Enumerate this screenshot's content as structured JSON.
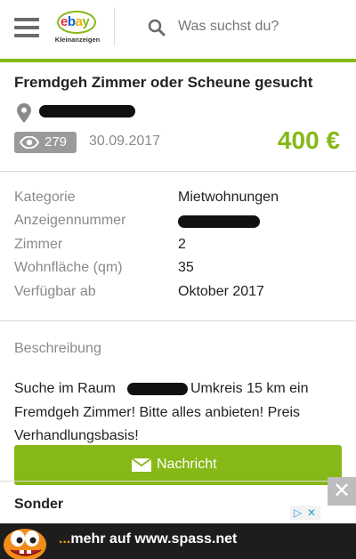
{
  "header": {
    "logo_brand": "ebay",
    "logo_sub": "Kleinanzeigen",
    "search_placeholder": "Was suchst du?"
  },
  "listing": {
    "title": "Fremdgeh Zimmer oder Scheune gesucht",
    "views": "279",
    "date": "30.09.2017",
    "price": "400 €"
  },
  "details": [
    {
      "key": "Kategorie",
      "value": "Mietwohnungen"
    },
    {
      "key": "Anzeigennummer",
      "value": ""
    },
    {
      "key": "Zimmer",
      "value": "2"
    },
    {
      "key": "Wohnfläche (qm)",
      "value": "35"
    },
    {
      "key": "Verfügbar ab",
      "value": "Oktober 2017"
    }
  ],
  "description": {
    "heading": "Beschreibung",
    "line1_a": "Suche im Raum",
    "line1_b": "Umkreis 15 km ein",
    "line2": "Fremdgeh Zimmer! Bitte alles anbieten! Preis",
    "line3": "Verhandlungsbasis!"
  },
  "contact_button": {
    "label": "Nachricht"
  },
  "cut_off_heading": "Sonder",
  "close_ad": "✕",
  "footer": {
    "dots": "...",
    "text": "mehr auf www.spass.net"
  },
  "colors": {
    "accent": "#86b817",
    "footer_bg": "#1d1d1d",
    "badge": "#9a9a9a"
  }
}
